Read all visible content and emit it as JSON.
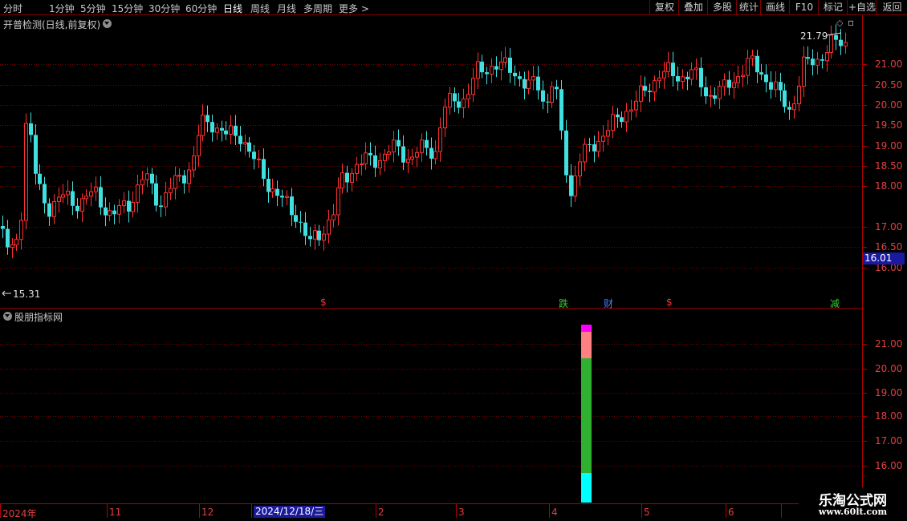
{
  "toolbar": {
    "periods": [
      "分时",
      "1分钟",
      "5分钟",
      "15分钟",
      "30分钟",
      "60分钟",
      "日线",
      "周线",
      "月线",
      "多周期",
      "更多 >"
    ],
    "active_period": "日线",
    "right_buttons": [
      "复权",
      "叠加",
      "多股",
      "统计",
      "画线",
      "F10",
      "+自选",
      "返回"
    ]
  },
  "main_panel": {
    "title": "开普检测(日线,前复权)",
    "y_ticks": [
      "21.00",
      "20.50",
      "20.00",
      "19.50",
      "19.00",
      "18.50",
      "18.00",
      "17.00",
      "16.50",
      "16.00"
    ],
    "high_label": "21.79",
    "low_label": "15.31",
    "current_price": "16.01",
    "signals": [
      {
        "text": "$",
        "color": "#ff3030"
      },
      {
        "text": "跌",
        "color": "#30d030"
      },
      {
        "text": "财",
        "color": "#4080ff"
      },
      {
        "text": "$",
        "color": "#ff3030"
      },
      {
        "text": "减",
        "color": "#30d030"
      }
    ]
  },
  "sub_panel": {
    "title": "股朋指标网",
    "y_ticks": [
      "21.00",
      "20.00",
      "19.00",
      "18.00",
      "17.00",
      "16.00"
    ]
  },
  "date_axis": {
    "labels": [
      "2024年",
      "11",
      "12",
      "2",
      "3",
      "4",
      "5",
      "6"
    ],
    "selected_date": "2024/12/18/三"
  },
  "watermark": {
    "title": "乐淘公式网",
    "url": "www.60lt.com"
  },
  "colors": {
    "up": "#ff3030",
    "down": "#40e0e0",
    "grid": "#800000",
    "bar_magenta": "#ff00ff",
    "bar_pink": "#ff8080",
    "bar_green": "#30b030",
    "bar_cyan": "#00ffff"
  }
}
